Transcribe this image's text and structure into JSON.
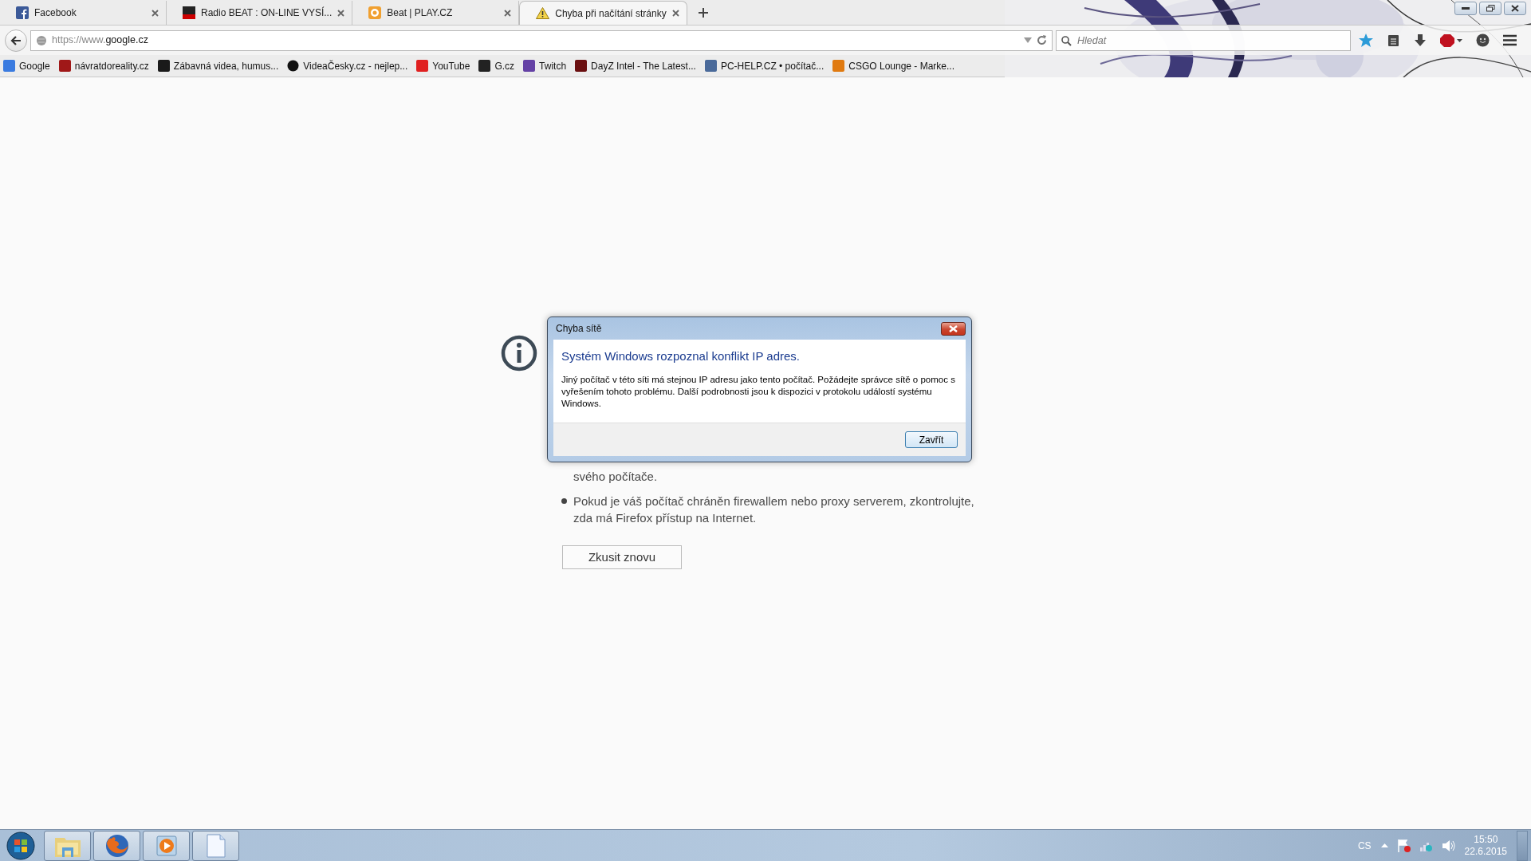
{
  "tabs": [
    {
      "title": "Facebook",
      "selected": false
    },
    {
      "title": "Radio BEAT : ON-LINE VYSÍ...",
      "selected": false
    },
    {
      "title": "Beat | PLAY.CZ",
      "selected": false
    },
    {
      "title": "Chyba při načítání stránky",
      "selected": true
    }
  ],
  "address": {
    "scheme": "https://www.",
    "host": "google.cz"
  },
  "search": {
    "placeholder": "Hledat"
  },
  "bookmarks": [
    {
      "label": "Google"
    },
    {
      "label": "návratdoreality.cz"
    },
    {
      "label": "Zábavná videa, humus..."
    },
    {
      "label": "VideaČesky.cz - nejlep..."
    },
    {
      "label": "YouTube"
    },
    {
      "label": "G.cz"
    },
    {
      "label": "Twitch"
    },
    {
      "label": "DayZ Intel - The Latest..."
    },
    {
      "label": "PC-HELP.CZ • počítač..."
    },
    {
      "label": "CSGO Lounge - Marke..."
    }
  ],
  "error_page": {
    "items": [
      {
        "kind": "continuation",
        "text": "svého počítače."
      },
      {
        "kind": "bullet",
        "text": "Pokud je váš počítač chráněn firewallem nebo proxy serverem, zkontrolujte, zda má Firefox přístup na Internet."
      }
    ],
    "retry_button": "Zkusit znovu"
  },
  "dialog": {
    "title": "Chyba sítě",
    "heading": "Systém Windows rozpoznal konflikt IP adres.",
    "message": "Jiný počítač v této síti má stejnou IP adresu jako tento počítač. Požádejte správce sítě o pomoc s vyřešením tohoto problému. Další podrobnosti jsou k dispozici v protokolu událostí systému Windows.",
    "button": "Zavřít"
  },
  "taskbar": {
    "language": "CS",
    "time": "15:50",
    "date": "22.6.2015"
  }
}
